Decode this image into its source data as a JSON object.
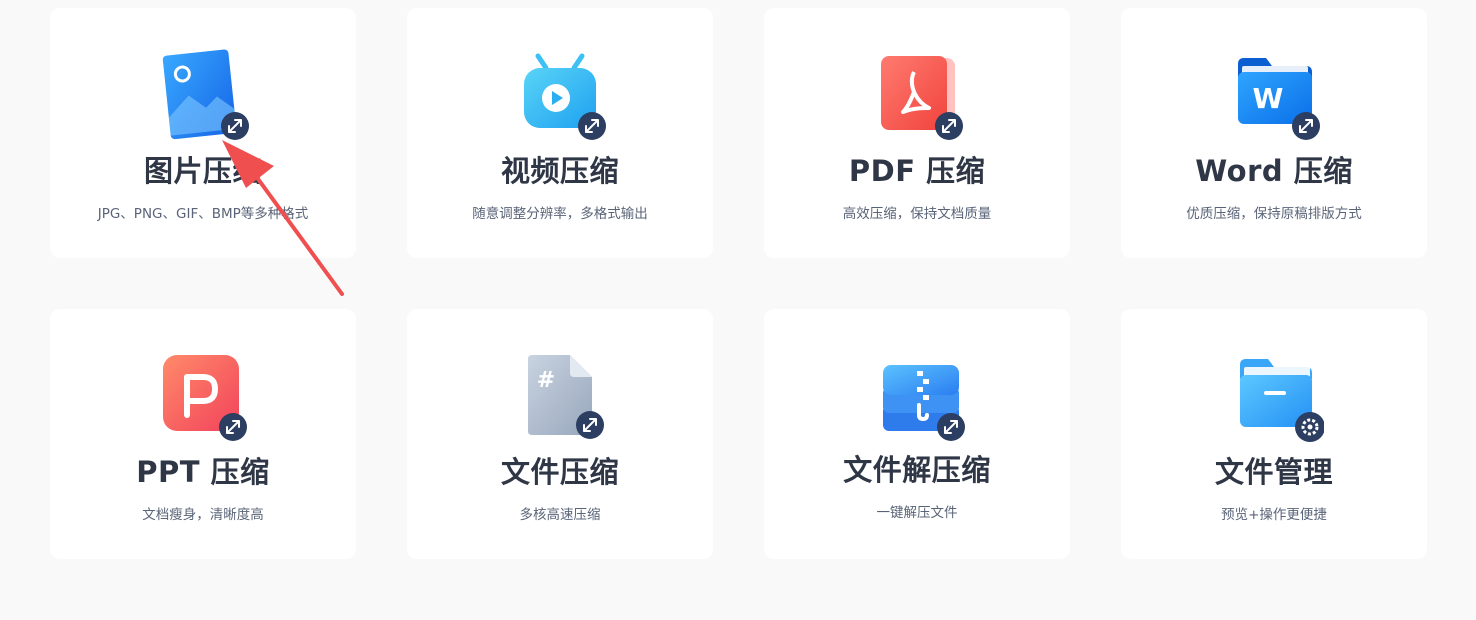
{
  "cards": [
    {
      "title": "图片压缩",
      "desc": "JPG、PNG、GIF、BMP等多种格式",
      "icon": "image-compress-icon"
    },
    {
      "title": "视频压缩",
      "desc": "随意调整分辨率，多格式输出",
      "icon": "video-compress-icon"
    },
    {
      "title": "PDF 压缩",
      "desc": "高效压缩，保持文档质量",
      "icon": "pdf-compress-icon"
    },
    {
      "title": "Word 压缩",
      "desc": "优质压缩，保持原稿排版方式",
      "icon": "word-compress-icon"
    },
    {
      "title": "PPT 压缩",
      "desc": "文档瘦身，清晰度高",
      "icon": "ppt-compress-icon"
    },
    {
      "title": "文件压缩",
      "desc": "多核高速压缩",
      "icon": "file-compress-icon"
    },
    {
      "title": "文件解压缩",
      "desc": "一键解压文件",
      "icon": "file-decompress-icon"
    },
    {
      "title": "文件管理",
      "desc": "预览+操作更便捷",
      "icon": "file-manage-icon"
    }
  ],
  "icon_glyphs": {
    "word": "W",
    "hash": "#"
  },
  "colors": {
    "card_bg": "#ffffff",
    "page_bg": "#f9f9fa",
    "title": "#2f3646",
    "desc": "#5a6478",
    "badge": "#2c3e62",
    "annotation_arrow": "#ef4f4f"
  }
}
